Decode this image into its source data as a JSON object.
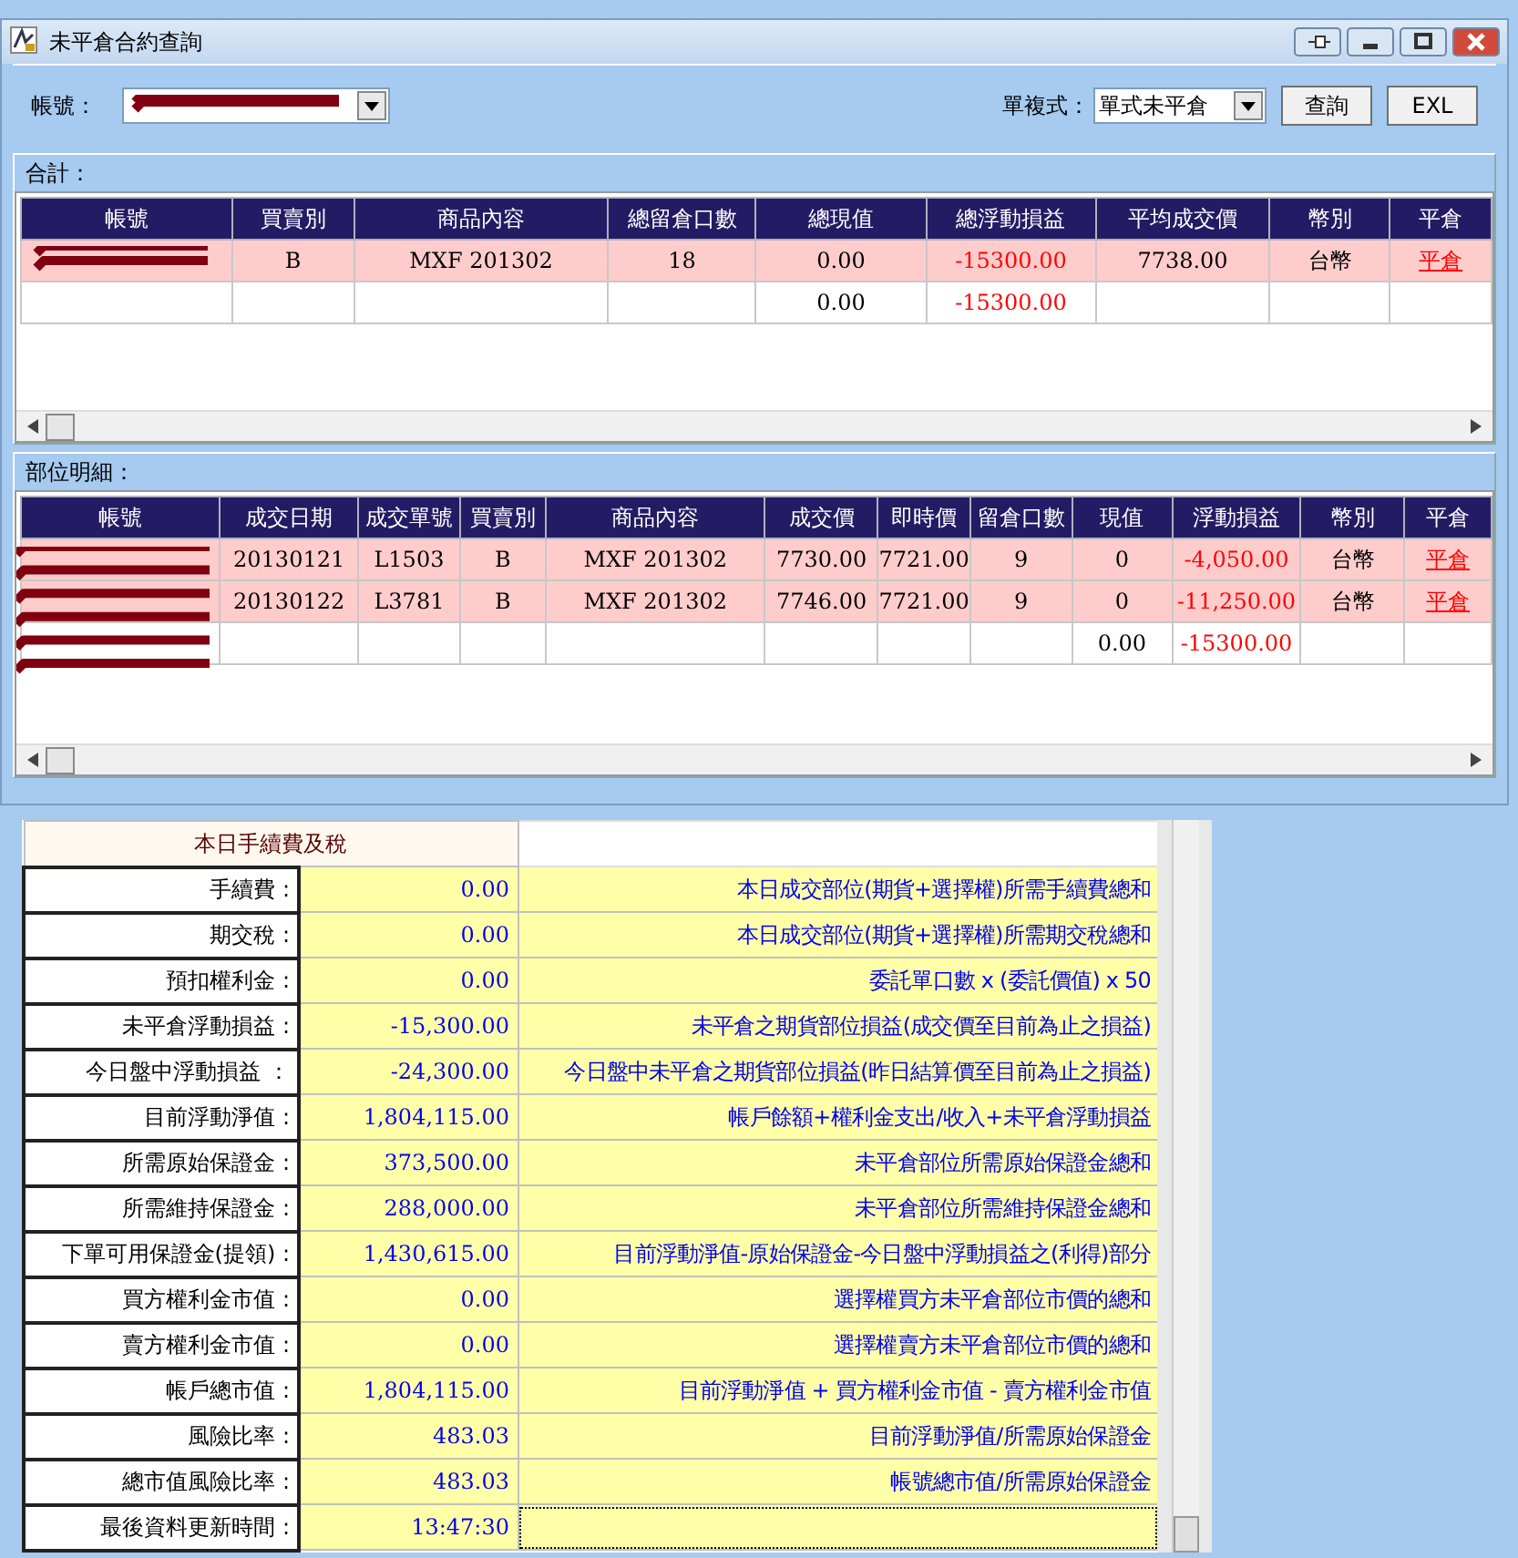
{
  "window": {
    "title": "未平倉合約查詢"
  },
  "toolbar": {
    "account_label": "帳號：",
    "account_redacted": true,
    "mode_label": "單複式：",
    "mode_value": "單式未平倉",
    "buttons": [
      "查詢",
      "EXL"
    ]
  },
  "summary": {
    "title": "合計：",
    "columns": [
      {
        "label": "帳號",
        "kind": "account"
      },
      {
        "label": "買賣別",
        "kind": "text"
      },
      {
        "label": "商品內容",
        "kind": "text"
      },
      {
        "label": "總留倉口數",
        "kind": "text"
      },
      {
        "label": "總現值",
        "kind": "text"
      },
      {
        "label": "總浮動損益",
        "kind": "pnl"
      },
      {
        "label": "平均成交價",
        "kind": "text"
      },
      {
        "label": "幣別",
        "kind": "text"
      },
      {
        "label": "平倉",
        "kind": "link"
      }
    ],
    "rows": [
      {
        "kind": "position",
        "account_redacted": true,
        "cells": [
          null,
          "B",
          "MXF 201302",
          "18",
          "0.00",
          "-15300.00",
          "7738.00",
          "台幣",
          "平倉"
        ]
      },
      {
        "kind": "total",
        "cells": [
          null,
          null,
          null,
          null,
          "0.00",
          "-15300.00",
          null,
          null,
          null
        ]
      }
    ]
  },
  "details": {
    "title": "部位明細：",
    "account_redacted": true,
    "columns": [
      {
        "label": "帳號",
        "kind": "account"
      },
      {
        "label": "成交日期",
        "kind": "text"
      },
      {
        "label": "成交單號",
        "kind": "text"
      },
      {
        "label": "買賣別",
        "kind": "text"
      },
      {
        "label": "商品內容",
        "kind": "text"
      },
      {
        "label": "成交價",
        "kind": "text"
      },
      {
        "label": "即時價",
        "kind": "text"
      },
      {
        "label": "留倉口數",
        "kind": "text"
      },
      {
        "label": "現值",
        "kind": "text"
      },
      {
        "label": "浮動損益",
        "kind": "pnl"
      },
      {
        "label": "幣別",
        "kind": "text"
      },
      {
        "label": "平倉",
        "kind": "link"
      }
    ],
    "rows": [
      {
        "kind": "position",
        "cells": [
          null,
          "20130121",
          "L1503",
          "B",
          "MXF 201302",
          "7730.00",
          "7721.00",
          "9",
          "0",
          "-4,050.00",
          "台幣",
          "平倉"
        ]
      },
      {
        "kind": "position",
        "cells": [
          null,
          "20130122",
          "L3781",
          "B",
          "MXF 201302",
          "7746.00",
          "7721.00",
          "9",
          "0",
          "-11,250.00",
          "台幣",
          "平倉"
        ]
      },
      {
        "kind": "total",
        "cells": [
          null,
          null,
          null,
          null,
          null,
          null,
          null,
          null,
          "0.00",
          "-15300.00",
          null,
          null
        ]
      }
    ]
  },
  "fees": {
    "title": "本日手續費及稅",
    "rows": [
      {
        "label": "手續費 :",
        "value": "0.00",
        "description": "本日成交部位(期貨+選擇權)所需手續費總和"
      },
      {
        "label": "期交稅 :",
        "value": "0.00",
        "description": "本日成交部位(期貨+選擇權)所需期交稅總和"
      },
      {
        "label": "預扣權利金 :",
        "value": "0.00",
        "description": "委託單口數 x (委託價值) x 50"
      },
      {
        "label": "未平倉浮動損益 :",
        "value": "-15,300.00",
        "description": "未平倉之期貨部位損益(成交價至目前為止之損益)"
      },
      {
        "label": "今日盤中浮動損益 ：",
        "value": "-24,300.00",
        "description": "今日盤中未平倉之期貨部位損益(昨日結算價至目前為止之損益)"
      },
      {
        "label": "目前浮動淨值 :",
        "value": "1,804,115.00",
        "description": "帳戶餘額+權利金支出/收入+未平倉浮動損益"
      },
      {
        "label": "所需原始保證金 :",
        "value": "373,500.00",
        "description": "未平倉部位所需原始保證金總和"
      },
      {
        "label": "所需維持保證金 :",
        "value": "288,000.00",
        "description": "未平倉部位所需維持保證金總和"
      },
      {
        "label": "下單可用保證金(提領) :",
        "value": "1,430,615.00",
        "description": "目前浮動淨值-原始保證金-今日盤中浮動損益之(利得)部分"
      },
      {
        "label": "買方權利金市值 :",
        "value": "0.00",
        "description": "選擇權買方未平倉部位市價的總和"
      },
      {
        "label": "賣方權利金市值 :",
        "value": "0.00",
        "description": "選擇權賣方未平倉部位市價的總和"
      },
      {
        "label": "帳戶總市值 :",
        "value": "1,804,115.00",
        "description": "目前浮動淨值 + 買方權利金市值 - 賣方權利金市值"
      },
      {
        "label": "風險比率 :",
        "value": "483.03",
        "description": "目前浮動淨值/所需原始保證金"
      },
      {
        "label": "總市值風險比率 :",
        "value": "483.03",
        "description": "帳號總市值/所需原始保證金"
      },
      {
        "label": "最後資料更新時間 :",
        "value": "13:47:30"
      }
    ]
  }
}
